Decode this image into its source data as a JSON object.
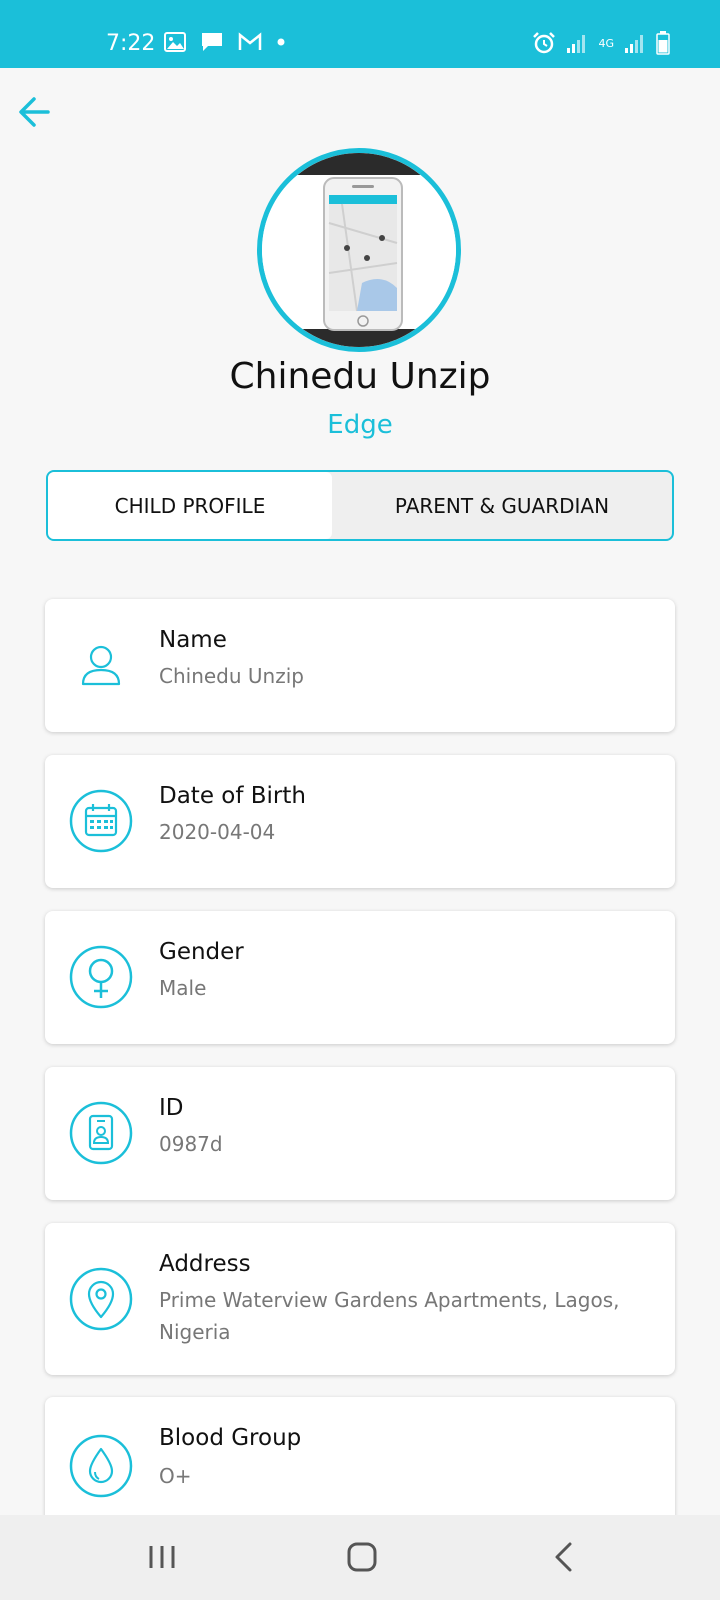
{
  "status_bar": {
    "time": "7:22",
    "network_label": "4G",
    "icons": [
      "image-icon",
      "message-icon",
      "gmail-icon",
      "dot-icon",
      "alarm-icon",
      "signal-icon",
      "battery-icon"
    ]
  },
  "header": {
    "back_icon": "arrow-left-icon"
  },
  "profile": {
    "name": "Chinedu Unzip",
    "subtitle": "Edge"
  },
  "tabs": [
    {
      "label": "CHILD PROFILE",
      "active": true
    },
    {
      "label": "PARENT & GUARDIAN",
      "active": false
    }
  ],
  "fields": [
    {
      "label": "Name",
      "value": "Chinedu Unzip",
      "icon": "person-icon"
    },
    {
      "label": "Date of Birth",
      "value": "2020-04-04",
      "icon": "calendar-icon"
    },
    {
      "label": "Gender",
      "value": "Male",
      "icon": "gender-icon"
    },
    {
      "label": "ID",
      "value": "0987d",
      "icon": "id-badge-icon"
    },
    {
      "label": "Address",
      "value": "Prime Waterview Gardens Apartments, Lagos, Nigeria",
      "icon": "location-pin-icon"
    },
    {
      "label": "Blood Group",
      "value": "O+",
      "icon": "blood-drop-icon"
    }
  ],
  "nav_bar": {
    "buttons": [
      "recent-apps-icon",
      "home-icon",
      "back-icon"
    ]
  },
  "colors": {
    "accent": "#1bbfd9",
    "background": "#f7f7f7",
    "value_text": "#777777"
  }
}
